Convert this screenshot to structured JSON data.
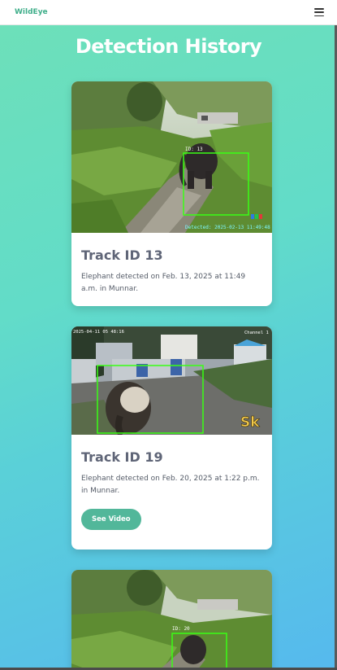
{
  "navbar": {
    "brand": "WildEye",
    "menu_icon": "hamburger-menu-icon"
  },
  "page": {
    "title": "Detection History"
  },
  "cards": [
    {
      "title": "Track ID 13",
      "text": "Elephant detected on Feb. 13, 2025 at 11:49 a.m. in Munnar.",
      "overlay_label": "ID: 13",
      "overlay_stamp": "Detected: 2025-02-13 11:49:48",
      "button": ""
    },
    {
      "title": "Track ID 19",
      "text": "Elephant detected on Feb. 20, 2025 at 1:22 p.m. in Munnar.",
      "overlay_timestamp": "2025-04-11 05 48:16",
      "overlay_channel": "Channel 1",
      "overlay_logo": "Sk",
      "button": "See Video"
    },
    {
      "overlay_label": "ID: 20"
    }
  ],
  "colors": {
    "brand": "#3fae8a",
    "button": "#52b79a",
    "detection_box": "#39ff14"
  }
}
